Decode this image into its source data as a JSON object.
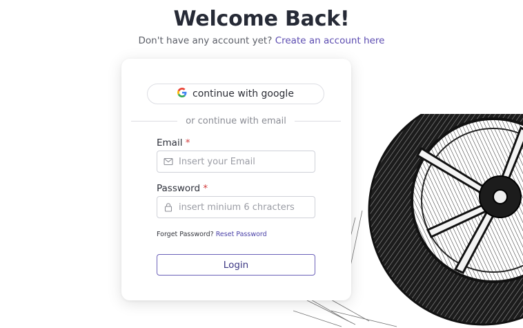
{
  "header": {
    "title": "Welcome Back!",
    "subtitle_prefix": "Don't have any account yet?",
    "create_account_link": "Create an account here"
  },
  "login_card": {
    "google_button_label": "continue with google",
    "divider_text": "or continue with email",
    "email": {
      "label": "Email",
      "required_marker": "*",
      "placeholder": "Insert your Email",
      "icon": "mail-icon"
    },
    "password": {
      "label": "Password",
      "required_marker": "*",
      "placeholder": "insert minium 6 chracters",
      "icon": "lock-icon"
    },
    "forgot_text": "Forget Password?",
    "reset_link": "Reset Password",
    "login_button_label": "Login"
  },
  "colors": {
    "accent": "#5b4bb0",
    "required": "#d23b3b",
    "title": "#262a36"
  },
  "decoration": {
    "illustration": "tire-sketch"
  }
}
